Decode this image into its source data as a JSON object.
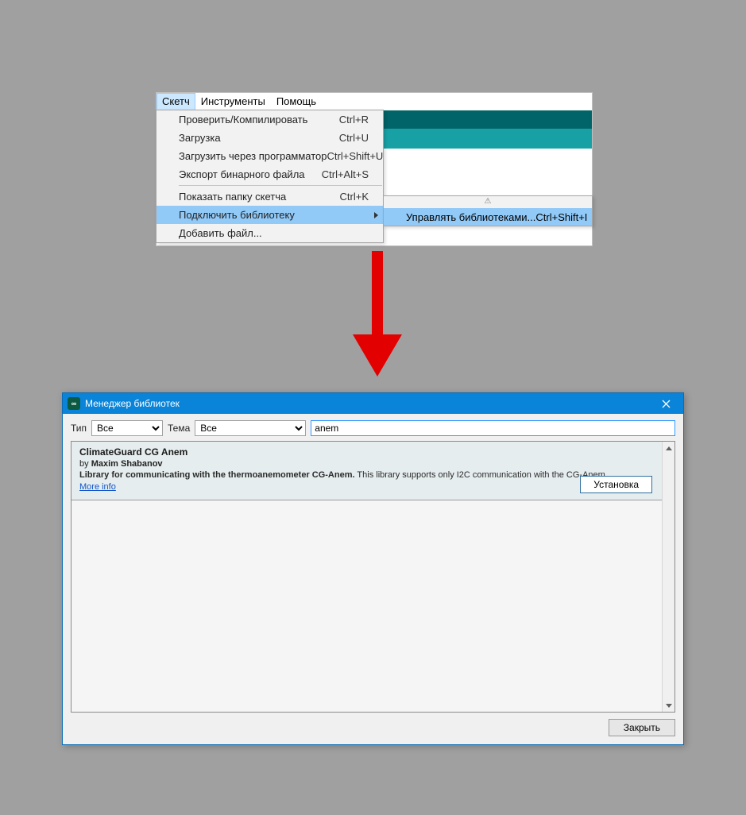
{
  "menubar": {
    "sketch": "Скетч",
    "tools": "Инструменты",
    "help": "Помощь"
  },
  "dropdown": {
    "items": [
      {
        "label": "Проверить/Компилировать",
        "shortcut": "Ctrl+R"
      },
      {
        "label": "Загрузка",
        "shortcut": "Ctrl+U"
      },
      {
        "label": "Загрузить через программатор",
        "shortcut": "Ctrl+Shift+U"
      },
      {
        "label": "Экспорт бинарного файла",
        "shortcut": "Ctrl+Alt+S"
      }
    ],
    "items2": [
      {
        "label": "Показать папку скетча",
        "shortcut": "Ctrl+K"
      },
      {
        "label": "Подключить библиотеку",
        "shortcut": ""
      },
      {
        "label": "Добавить файл...",
        "shortcut": ""
      }
    ]
  },
  "submenu": {
    "warn": "⚠",
    "manage_label": "Управлять библиотеками...",
    "manage_shortcut": "Ctrl+Shift+I"
  },
  "dialog": {
    "title": "Менеджер библиотек",
    "icon_text": "∞",
    "type_label": "Тип",
    "type_value": "Все",
    "theme_label": "Тема",
    "theme_value": "Все",
    "search_value": "anem",
    "close_btn": "Закрыть"
  },
  "lib": {
    "title": "ClimateGuard CG Anem",
    "by": "by ",
    "author": "Maxim Shabanov",
    "desc_bold": "Library for communicating with the thermoanemometer CG-Anem.",
    "desc_tail": " This library supports only I2C communication with the CG-Anem.",
    "more": "More info",
    "install": "Установка"
  }
}
